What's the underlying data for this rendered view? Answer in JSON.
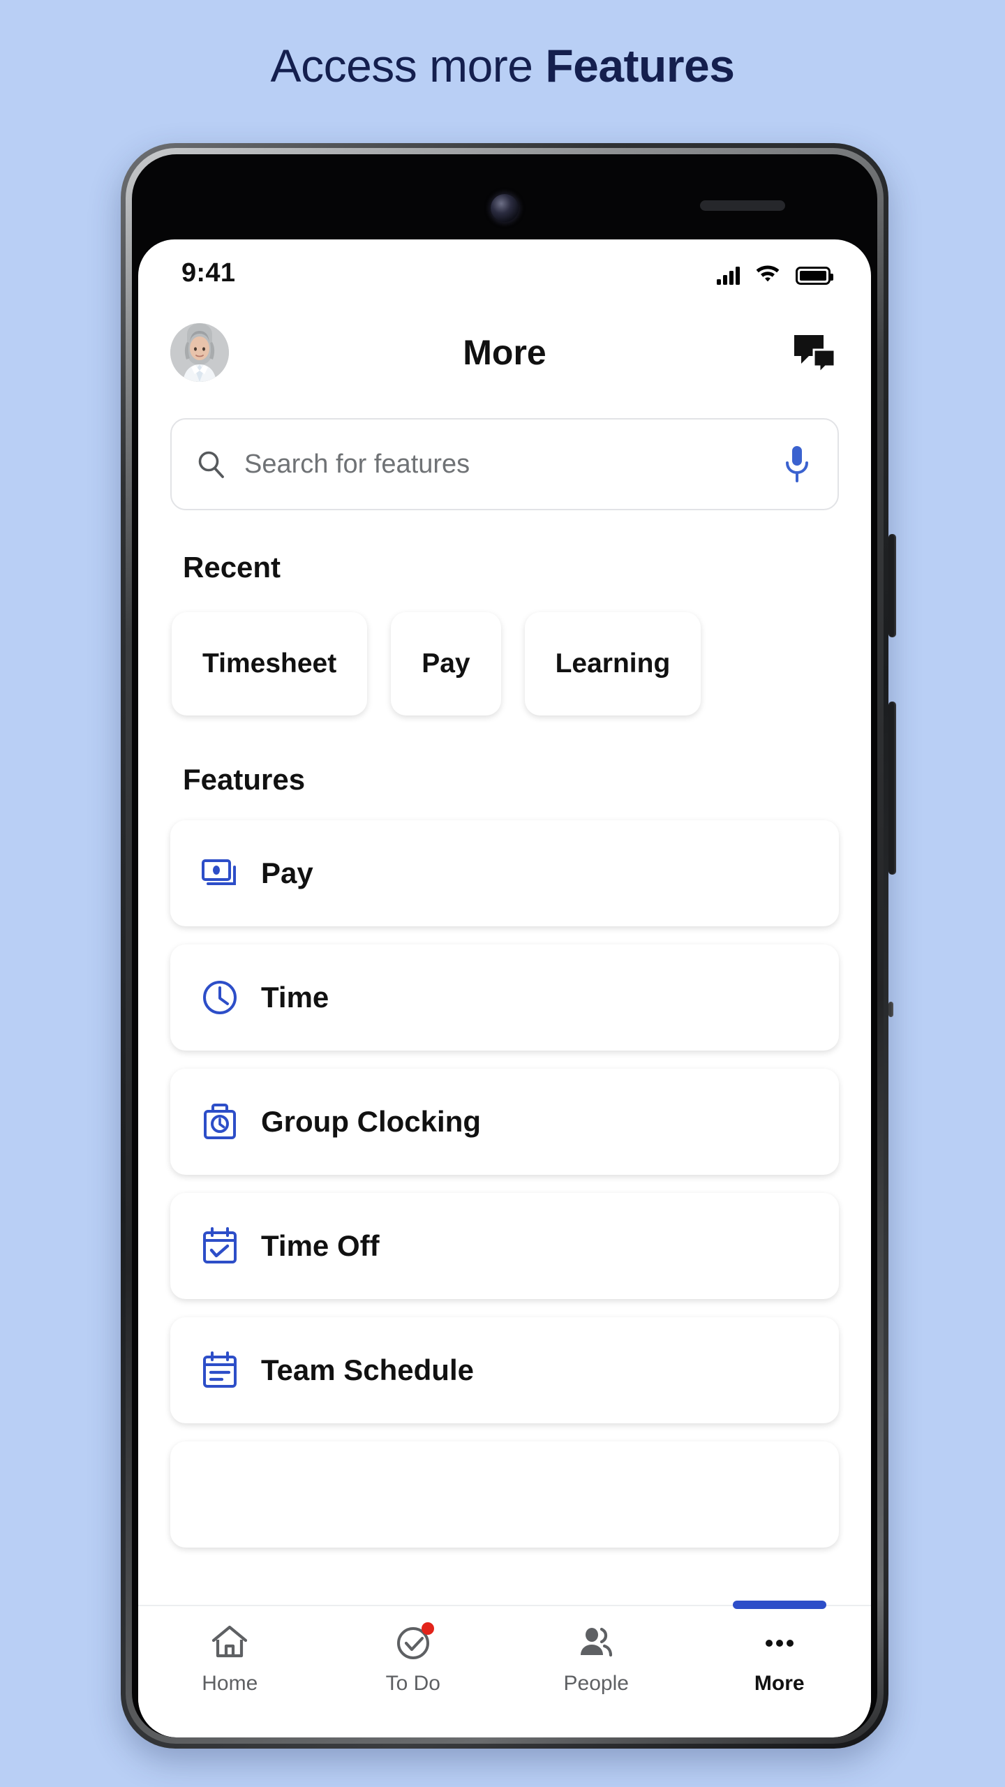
{
  "marketing": {
    "headline_light": "Access more ",
    "headline_bold": "Features",
    "background_color": "#b9cff5",
    "headline_color": "#141f4e"
  },
  "statusbar": {
    "time": "9:41",
    "signal_icon": "signal-bars-icon",
    "wifi_icon": "wifi-icon",
    "battery_icon": "battery-full-icon"
  },
  "appbar": {
    "title": "More",
    "avatar_icon": "user-avatar-photo",
    "chat_icon": "chat-bubbles-icon"
  },
  "search": {
    "placeholder": "Search for features",
    "value": "",
    "search_icon": "search-icon",
    "mic_icon": "microphone-icon",
    "mic_color": "#3b62cf"
  },
  "recent": {
    "title": "Recent",
    "chips": [
      {
        "label": "Timesheet"
      },
      {
        "label": "Pay"
      },
      {
        "label": "Learning"
      }
    ]
  },
  "features": {
    "title": "Features",
    "icon_color": "#2d4ec8",
    "items": [
      {
        "label": "Pay",
        "icon": "money-banknote-icon"
      },
      {
        "label": "Time",
        "icon": "clock-icon"
      },
      {
        "label": "Group Clocking",
        "icon": "time-clock-punch-icon"
      },
      {
        "label": "Time Off",
        "icon": "calendar-check-icon"
      },
      {
        "label": "Team Schedule",
        "icon": "calendar-list-icon"
      }
    ]
  },
  "bottomnav": {
    "items": [
      {
        "label": "Home",
        "icon": "home-icon",
        "active": false,
        "badge": false
      },
      {
        "label": "To Do",
        "icon": "check-circle-icon",
        "active": false,
        "badge": true
      },
      {
        "label": "People",
        "icon": "people-icon",
        "active": false,
        "badge": false
      },
      {
        "label": "More",
        "icon": "ellipsis-icon",
        "active": true,
        "badge": false
      }
    ],
    "indicator_color": "#2d4ec8",
    "badge_color": "#e2231a"
  }
}
